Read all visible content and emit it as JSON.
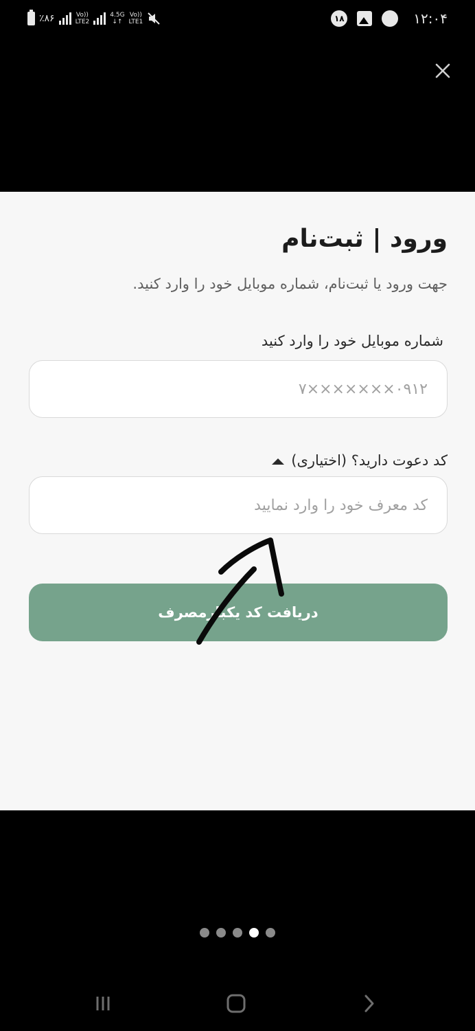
{
  "status_bar": {
    "battery_percent": "٪۸۶",
    "sim1_label_top": "Vo))",
    "sim1_label_bottom": "LTE2",
    "sim2_net": "4.5G",
    "sim2_label_top": "Vo))",
    "sim2_label_bottom": "LTE1",
    "notification_count": "۱۸",
    "time": "۱۲:۰۴"
  },
  "form": {
    "title": "ورود | ثبت‌نام",
    "subtitle": "جهت ورود یا ثبت‌نام، شماره موبایل خود را وارد کنید.",
    "phone_label": "شماره موبایل خود را وارد کنید",
    "phone_placeholder": "۰۹۱۲×××××××۷",
    "invite_toggle_label": "کد دعوت دارید؟ (اختیاری)",
    "referral_placeholder": "کد معرف خود را وارد نمایید",
    "submit_label": "دریافت کد یکبارمصرف"
  },
  "pager": {
    "count": 5,
    "active_index": 3
  },
  "colors": {
    "sheet_bg": "#f7f7f7",
    "button_green": "#76a38c",
    "title_text": "#1c1c1c",
    "muted_text": "#5e5e5e"
  },
  "icons": {
    "close": "close-icon",
    "caret": "caret-up-icon",
    "nav_recent": "recent-apps-icon",
    "nav_home": "home-icon",
    "nav_back": "back-icon"
  }
}
